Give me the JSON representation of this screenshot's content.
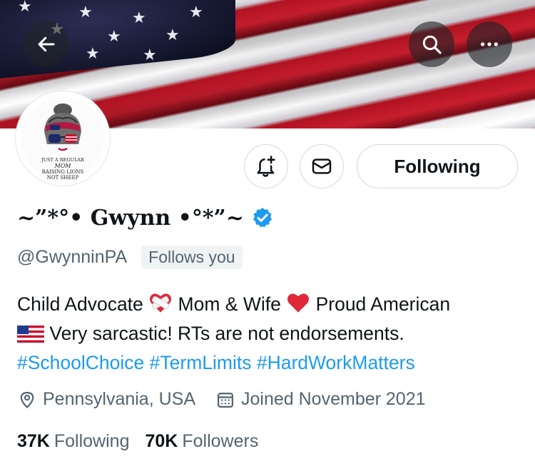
{
  "banner": {
    "description_icon": "us-flag-banner"
  },
  "header_buttons": {
    "back_icon": "arrow-left-icon",
    "search_icon": "search-icon",
    "more_icon": "more-horizontal-icon"
  },
  "avatar": {
    "badge_line1": "JUST A REGULAR",
    "badge_line2": "MOM",
    "badge_line3": "RAISING LIONS",
    "badge_line4": "NOT SHEEP"
  },
  "actions": {
    "notify_icon": "bell-plus-icon",
    "message_icon": "envelope-icon",
    "following_label": "Following"
  },
  "profile": {
    "display_name": "~”*°• Gwynn •°*”~",
    "handle": "@GwynninPA",
    "follows_you": "Follows you",
    "verified_color": "#1d9bf0"
  },
  "bio": {
    "line1_a": "Child Advocate",
    "line1_b": "Mom & Wife",
    "line1_c": "Proud American",
    "line2": "Very sarcastic! RTs are not endorsements.",
    "hashtags": [
      "#SchoolChoice",
      "#TermLimits",
      "#HardWorkMatters"
    ]
  },
  "meta": {
    "location": "Pennsylvania, USA",
    "joined": "Joined November 2021"
  },
  "counts": {
    "following_num": "37K",
    "following_label": "Following",
    "followers_num": "70K",
    "followers_label": "Followers"
  },
  "colors": {
    "link": "#1d9bf0",
    "secondary_text": "#536471",
    "primary_text": "#0f1419"
  }
}
